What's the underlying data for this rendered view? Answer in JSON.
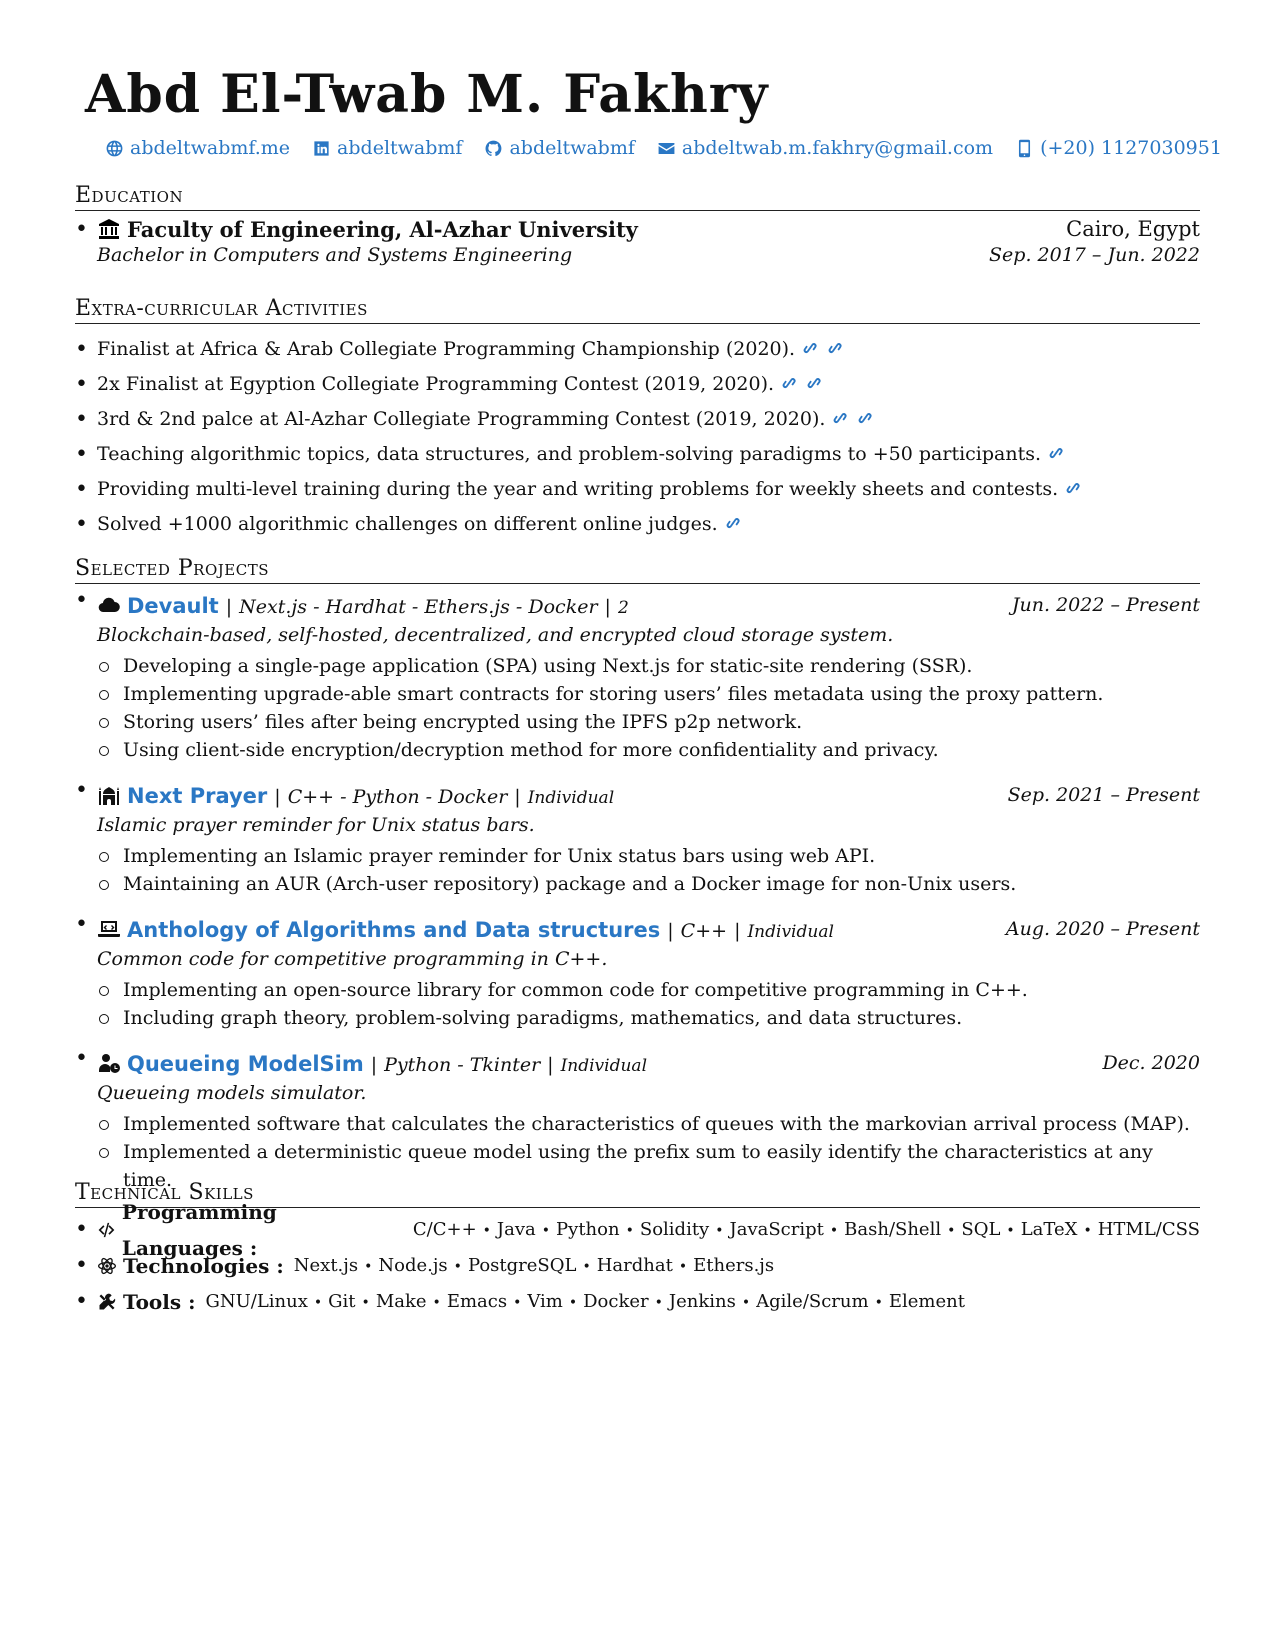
{
  "header": {
    "name": "Abd El-Twab M. Fakhry",
    "contacts": [
      {
        "icon": "globe-icon",
        "text": "abdeltwabmf.me"
      },
      {
        "icon": "linkedin-icon",
        "text": "abdeltwabmf"
      },
      {
        "icon": "github-icon",
        "text": "abdeltwabmf"
      },
      {
        "icon": "envelope-icon",
        "text": "abdeltwab.m.fakhry@gmail.com"
      },
      {
        "icon": "phone-icon",
        "text": "(+20) 1127030951"
      }
    ]
  },
  "education": {
    "title": "Education",
    "entries": [
      {
        "school": "Faculty of Engineering, Al-Azhar University",
        "location": "Cairo, Egypt",
        "degree": "Bachelor in Computers and Systems Engineering",
        "dates": "Sep. 2017 – Jun. 2022"
      }
    ]
  },
  "activities": {
    "title": "Extra-curricular Activities",
    "items": [
      {
        "text": "Finalist at Africa & Arab Collegiate Programming Championship (2020).",
        "links": 2
      },
      {
        "text": "2x Finalist at Egyption Collegiate Programming Contest (2019, 2020).",
        "links": 2
      },
      {
        "text": "3rd & 2nd palce at Al-Azhar Collegiate Programming Contest (2019, 2020).",
        "links": 2
      },
      {
        "text": "Teaching algorithmic topics, data structures, and problem-solving paradigms to +50 participants.",
        "links": 1
      },
      {
        "text": "Providing multi-level training during the year and writing problems for weekly sheets and contests.",
        "links": 1
      },
      {
        "text": "Solved +1000 algorithmic challenges on different online judges.",
        "links": 1
      }
    ]
  },
  "projects": {
    "title": "Selected Projects",
    "items": [
      {
        "icon": "cloud-icon",
        "name": "Devault",
        "tech": "Next.js - Hardhat - Ethers.js - Docker",
        "team": "2",
        "dates": "Jun. 2022 – Present",
        "desc": "Blockchain-based, self-hosted, decentralized, and encrypted cloud storage system.",
        "points": [
          "Developing a single-page application (SPA) using Next.js for static-site rendering (SSR).",
          "Implementing upgrade-able smart contracts for storing users’ files metadata using the proxy pattern.",
          "Storing users’ files after being encrypted using the IPFS p2p network.",
          "Using client-side encryption/decryption method for more confidentiality and privacy."
        ]
      },
      {
        "icon": "mosque-icon",
        "name": "Next Prayer",
        "tech": "C++ - Python - Docker",
        "team": "Individual",
        "dates": "Sep. 2021 – Present",
        "desc": "Islamic prayer reminder for Unix status bars.",
        "points": [
          "Implementing an Islamic prayer reminder for Unix status bars using web API.",
          "Maintaining an AUR (Arch-user repository) package and a Docker image for non-Unix users."
        ]
      },
      {
        "icon": "laptop-code-icon",
        "name": "Anthology of Algorithms and Data structures",
        "tech": "C++",
        "team": "Individual",
        "dates": "Aug. 2020 – Present",
        "desc": "Common code for competitive programming in C++.",
        "points": [
          "Implementing an open-source library for common code for competitive programming in C++.",
          "Including graph theory, problem-solving paradigms, mathematics, and data structures."
        ]
      },
      {
        "icon": "user-clock-icon",
        "name": "Queueing ModelSim",
        "tech": "Python - Tkinter",
        "team": "Individual",
        "dates": "Dec. 2020",
        "desc": "Queueing models simulator.",
        "points": [
          "Implemented software that calculates the characteristics of queues with the markovian arrival process (MAP).",
          "Implemented a deterministic queue model using the prefix sum to easily identify the characteristics at any time."
        ]
      }
    ]
  },
  "skills": {
    "title": "Technical Skills",
    "groups": [
      {
        "icon": "code-icon",
        "label": "Programming Languages :",
        "items": [
          "C/C++",
          "Java",
          "Python",
          "Solidity",
          "JavaScript",
          "Bash/Shell",
          "SQL",
          "LaTeX",
          "HTML/CSS"
        ]
      },
      {
        "icon": "atom-icon",
        "label": "Technologies :",
        "items": [
          "Next.js",
          "Node.js",
          "PostgreSQL",
          "Hardhat",
          "Ethers.js"
        ]
      },
      {
        "icon": "tools-icon",
        "label": "Tools :",
        "items": [
          "GNU/Linux",
          "Git",
          "Make",
          "Emacs",
          "Vim",
          "Docker",
          "Jenkins",
          "Agile/Scrum",
          "Element"
        ]
      }
    ]
  },
  "colors": {
    "link": "#2a77c4",
    "text": "#111111"
  }
}
